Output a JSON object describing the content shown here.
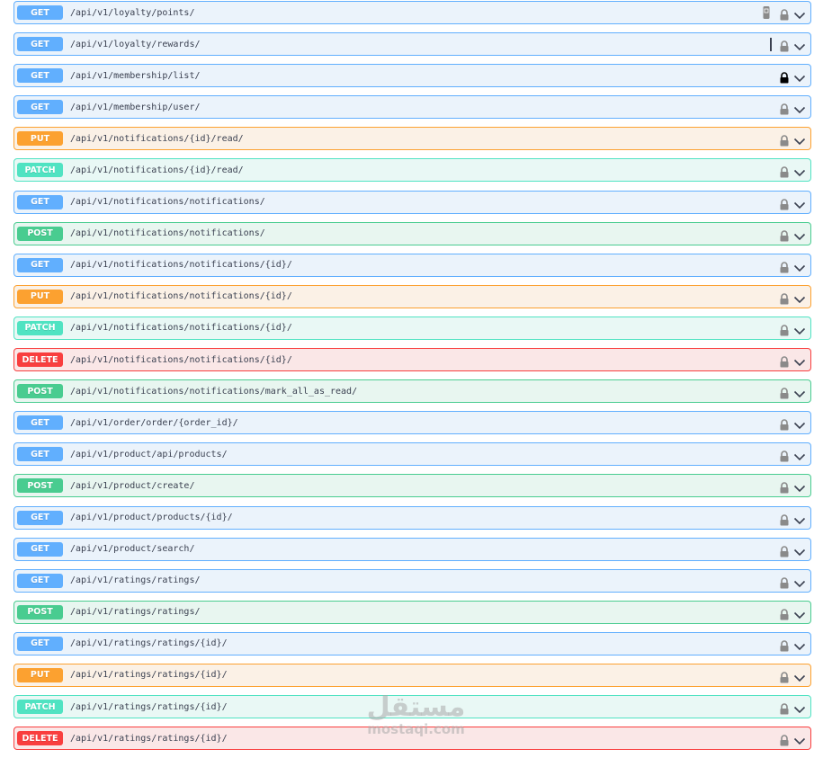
{
  "endpoints": [
    {
      "method": "GET",
      "path": "/api/v1/loyalty/points/",
      "lock": "unlocked"
    },
    {
      "method": "GET",
      "path": "/api/v1/loyalty/rewards/",
      "lock": "unlocked"
    },
    {
      "method": "GET",
      "path": "/api/v1/membership/list/",
      "lock": "locked"
    },
    {
      "method": "GET",
      "path": "/api/v1/membership/user/",
      "lock": "unlocked"
    },
    {
      "method": "PUT",
      "path": "/api/v1/notifications/{id}/read/",
      "lock": "unlocked"
    },
    {
      "method": "PATCH",
      "path": "/api/v1/notifications/{id}/read/",
      "lock": "unlocked"
    },
    {
      "method": "GET",
      "path": "/api/v1/notifications/notifications/",
      "lock": "unlocked"
    },
    {
      "method": "POST",
      "path": "/api/v1/notifications/notifications/",
      "lock": "unlocked"
    },
    {
      "method": "GET",
      "path": "/api/v1/notifications/notifications/{id}/",
      "lock": "unlocked"
    },
    {
      "method": "PUT",
      "path": "/api/v1/notifications/notifications/{id}/",
      "lock": "unlocked"
    },
    {
      "method": "PATCH",
      "path": "/api/v1/notifications/notifications/{id}/",
      "lock": "unlocked"
    },
    {
      "method": "DELETE",
      "path": "/api/v1/notifications/notifications/{id}/",
      "lock": "unlocked"
    },
    {
      "method": "POST",
      "path": "/api/v1/notifications/notifications/mark_all_as_read/",
      "lock": "unlocked"
    },
    {
      "method": "GET",
      "path": "/api/v1/order/order/{order_id}/",
      "lock": "unlocked"
    },
    {
      "method": "GET",
      "path": "/api/v1/product/api/products/",
      "lock": "unlocked"
    },
    {
      "method": "POST",
      "path": "/api/v1/product/create/",
      "lock": "unlocked"
    },
    {
      "method": "GET",
      "path": "/api/v1/product/products/{id}/",
      "lock": "unlocked"
    },
    {
      "method": "GET",
      "path": "/api/v1/product/search/",
      "lock": "unlocked"
    },
    {
      "method": "GET",
      "path": "/api/v1/ratings/ratings/",
      "lock": "unlocked"
    },
    {
      "method": "POST",
      "path": "/api/v1/ratings/ratings/",
      "lock": "unlocked"
    },
    {
      "method": "GET",
      "path": "/api/v1/ratings/ratings/{id}/",
      "lock": "unlocked"
    },
    {
      "method": "PUT",
      "path": "/api/v1/ratings/ratings/{id}/",
      "lock": "unlocked"
    },
    {
      "method": "PATCH",
      "path": "/api/v1/ratings/ratings/{id}/",
      "lock": "unlocked"
    },
    {
      "method": "DELETE",
      "path": "/api/v1/ratings/ratings/{id}/",
      "lock": "unlocked"
    }
  ],
  "icons": {
    "lock": "lock-icon",
    "expand": "chevron-down-icon"
  },
  "colors": {
    "GET": "#61affe",
    "PUT": "#fca130",
    "PATCH": "#50e3c2",
    "POST": "#49cc90",
    "DELETE": "#f93e3e",
    "lock_unlocked": "#8a8a8a",
    "lock_locked": "#000000"
  },
  "watermark": {
    "arabic": "مستقل",
    "latin": "mostaqi.com"
  }
}
